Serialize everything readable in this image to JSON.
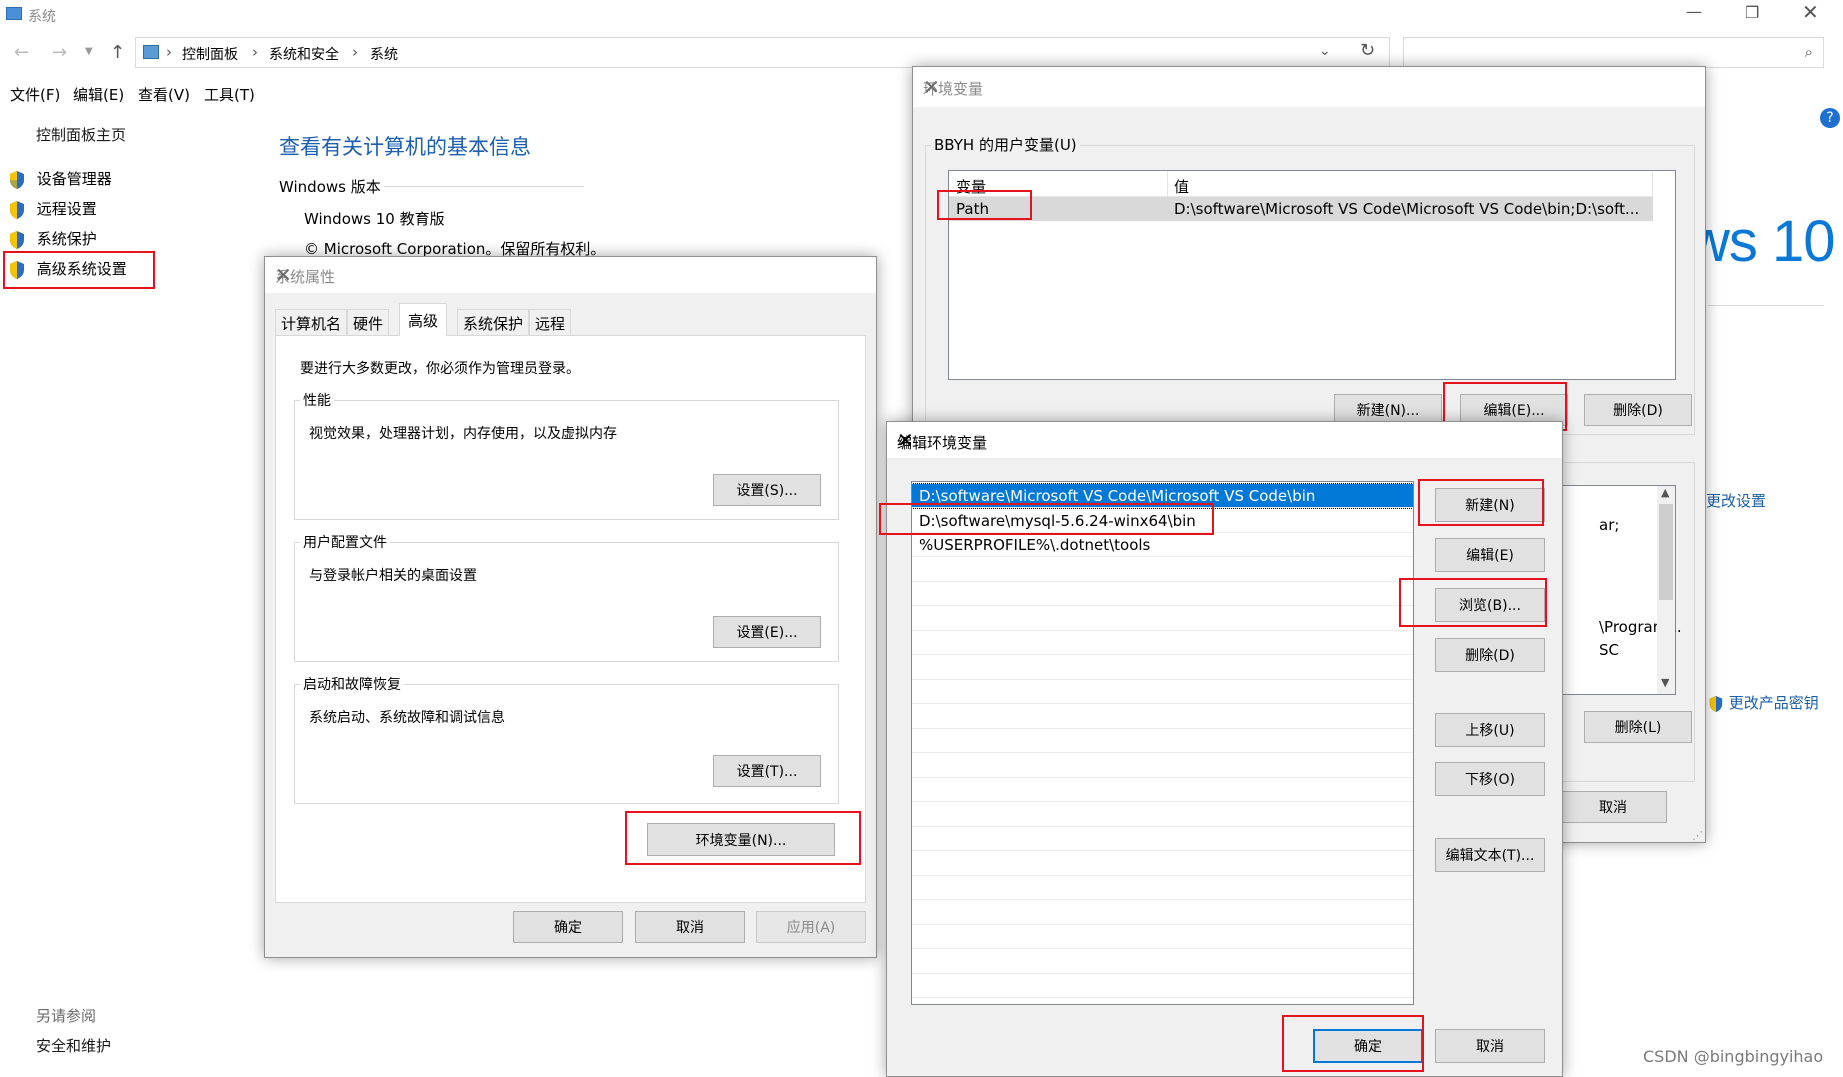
{
  "window": {
    "title": "系统"
  },
  "breadcrumb": [
    "控制面板",
    "系统和安全",
    "系统"
  ],
  "menu": [
    "文件(F)",
    "编辑(E)",
    "查看(V)",
    "工具(T)"
  ],
  "sidebar": {
    "home": "控制面板主页",
    "items": [
      "设备管理器",
      "远程设置",
      "系统保护",
      "高级系统设置"
    ],
    "see_also_title": "另请参阅",
    "see_also_item": "安全和维护"
  },
  "main": {
    "title": "查看有关计算机的基本信息",
    "windows_edition_label": "Windows 版本",
    "edition": "Windows 10 教育版",
    "copyright": "© Microsoft Corporation。保留所有权利。",
    "logo_text": "ws 10",
    "change_settings": "更改设置",
    "change_product_key": "更改产品密钥"
  },
  "sys_props": {
    "title": "系统属性",
    "tabs": [
      "计算机名",
      "硬件",
      "高级",
      "系统保护",
      "远程"
    ],
    "admin_note": "要进行大多数更改，你必须作为管理员登录。",
    "perf_label": "性能",
    "perf_desc": "视觉效果，处理器计划，内存使用，以及虚拟内存",
    "perf_btn": "设置(S)...",
    "profile_label": "用户配置文件",
    "profile_desc": "与登录帐户相关的桌面设置",
    "profile_btn": "设置(E)...",
    "startup_label": "启动和故障恢复",
    "startup_desc": "系统启动、系统故障和调试信息",
    "startup_btn": "设置(T)...",
    "env_btn": "环境变量(N)...",
    "ok": "确定",
    "cancel": "取消",
    "apply": "应用(A)"
  },
  "env_vars": {
    "title": "环境变量",
    "user_group": "BBYH 的用户变量(U)",
    "col_var": "变量",
    "col_val": "值",
    "row_var": "Path",
    "row_val": "D:\\software\\Microsoft VS Code\\Microsoft VS Code\\bin;D:\\soft...",
    "new_btn": "新建(N)...",
    "edit_btn": "编辑(E)...",
    "delete_btn": "删除(D)",
    "sys_partial_1": "ar;",
    "sys_partial_2": "\\Program...",
    "sys_partial_3": "SC",
    "sys_delete_btn": "删除(L)",
    "cancel_btn": "取消"
  },
  "edit_env": {
    "title": "编辑环境变量",
    "entries": [
      "D:\\software\\Microsoft VS Code\\Microsoft VS Code\\bin",
      "D:\\software\\mysql-5.6.24-winx64\\bin",
      "%USERPROFILE%\\.dotnet\\tools"
    ],
    "new_btn": "新建(N)",
    "edit_btn": "编辑(E)",
    "browse_btn": "浏览(B)...",
    "delete_btn": "删除(D)",
    "up_btn": "上移(U)",
    "down_btn": "下移(O)",
    "edit_text_btn": "编辑文本(T)...",
    "ok": "确定",
    "cancel": "取消"
  },
  "watermark": "CSDN @bingbingyihao",
  "colors": {
    "accent": "#0078d7",
    "highlight": "#e5111b",
    "link": "#1a5ea8"
  }
}
